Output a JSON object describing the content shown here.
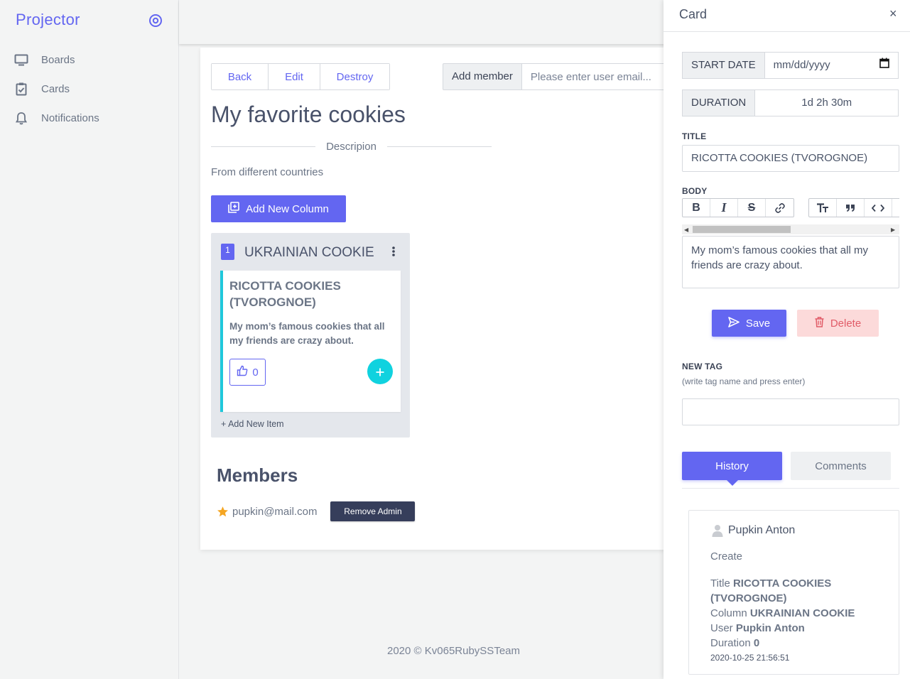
{
  "app": {
    "brand": "Projector"
  },
  "sidebar": {
    "items": [
      {
        "label": "Boards",
        "icon": "monitor-icon"
      },
      {
        "label": "Cards",
        "icon": "clipboard-check-icon"
      },
      {
        "label": "Notifications",
        "icon": "bell-icon"
      }
    ]
  },
  "board": {
    "buttons": {
      "back": "Back",
      "edit": "Edit",
      "destroy": "Destroy"
    },
    "add_member_label": "Add member",
    "member_email_placeholder": "Please enter user email...",
    "title": "My favorite cookies",
    "description_label": "Descripion",
    "description": "From different countries",
    "add_column_label": "Add New Column",
    "columns": [
      {
        "number": "1",
        "title": "UKRAINIAN COOKIE",
        "cards": [
          {
            "title": "RICOTTA COOKIES (TVOROGNOE)",
            "body": "My mom’s famous cookies that all my friends are crazy about.",
            "likes": "0"
          }
        ],
        "add_item_label": "+ Add New Item"
      }
    ],
    "members_title": "Members",
    "members": [
      {
        "email": "pupkin@mail.com",
        "action": "Remove Admin"
      }
    ]
  },
  "footer": {
    "text": "2020 © Kv065RubySSTeam"
  },
  "panel": {
    "title": "Card",
    "close": "×",
    "start_date_label": "START DATE",
    "start_date_value": "mm/dd/yyyy",
    "duration_label": "DURATION",
    "duration_value": "1d 2h 30m",
    "title_label": "TITLE",
    "title_value": "RICOTTA COOKIES (TVOROGNOE)",
    "body_label": "BODY",
    "body_value": "My mom’s famous cookies that all my friends are crazy about.",
    "save_label": "Save",
    "delete_label": "Delete",
    "new_tag_label": "NEW TAG",
    "new_tag_hint": "(write tag name and press enter)",
    "tabs": {
      "history": "History",
      "comments": "Comments"
    },
    "history": [
      {
        "user": "Pupkin Anton",
        "action": "Create",
        "title_key": "Title",
        "title_val": "RICOTTA COOKIES (TVOROGNOE)",
        "column_key": "Column",
        "column_val": "UKRAINIAN COOKIE",
        "user_key": "User",
        "user_val": "Pupkin Anton",
        "duration_key": "Duration",
        "duration_val": "0",
        "date": "2020-10-25 21:56:51"
      }
    ]
  },
  "colors": {
    "accent": "#6366f1",
    "teal": "#10d2df",
    "danger_bg": "#fcdada",
    "danger_text": "#e15b67",
    "dark_button": "#363e5b",
    "star": "#f5a623"
  }
}
